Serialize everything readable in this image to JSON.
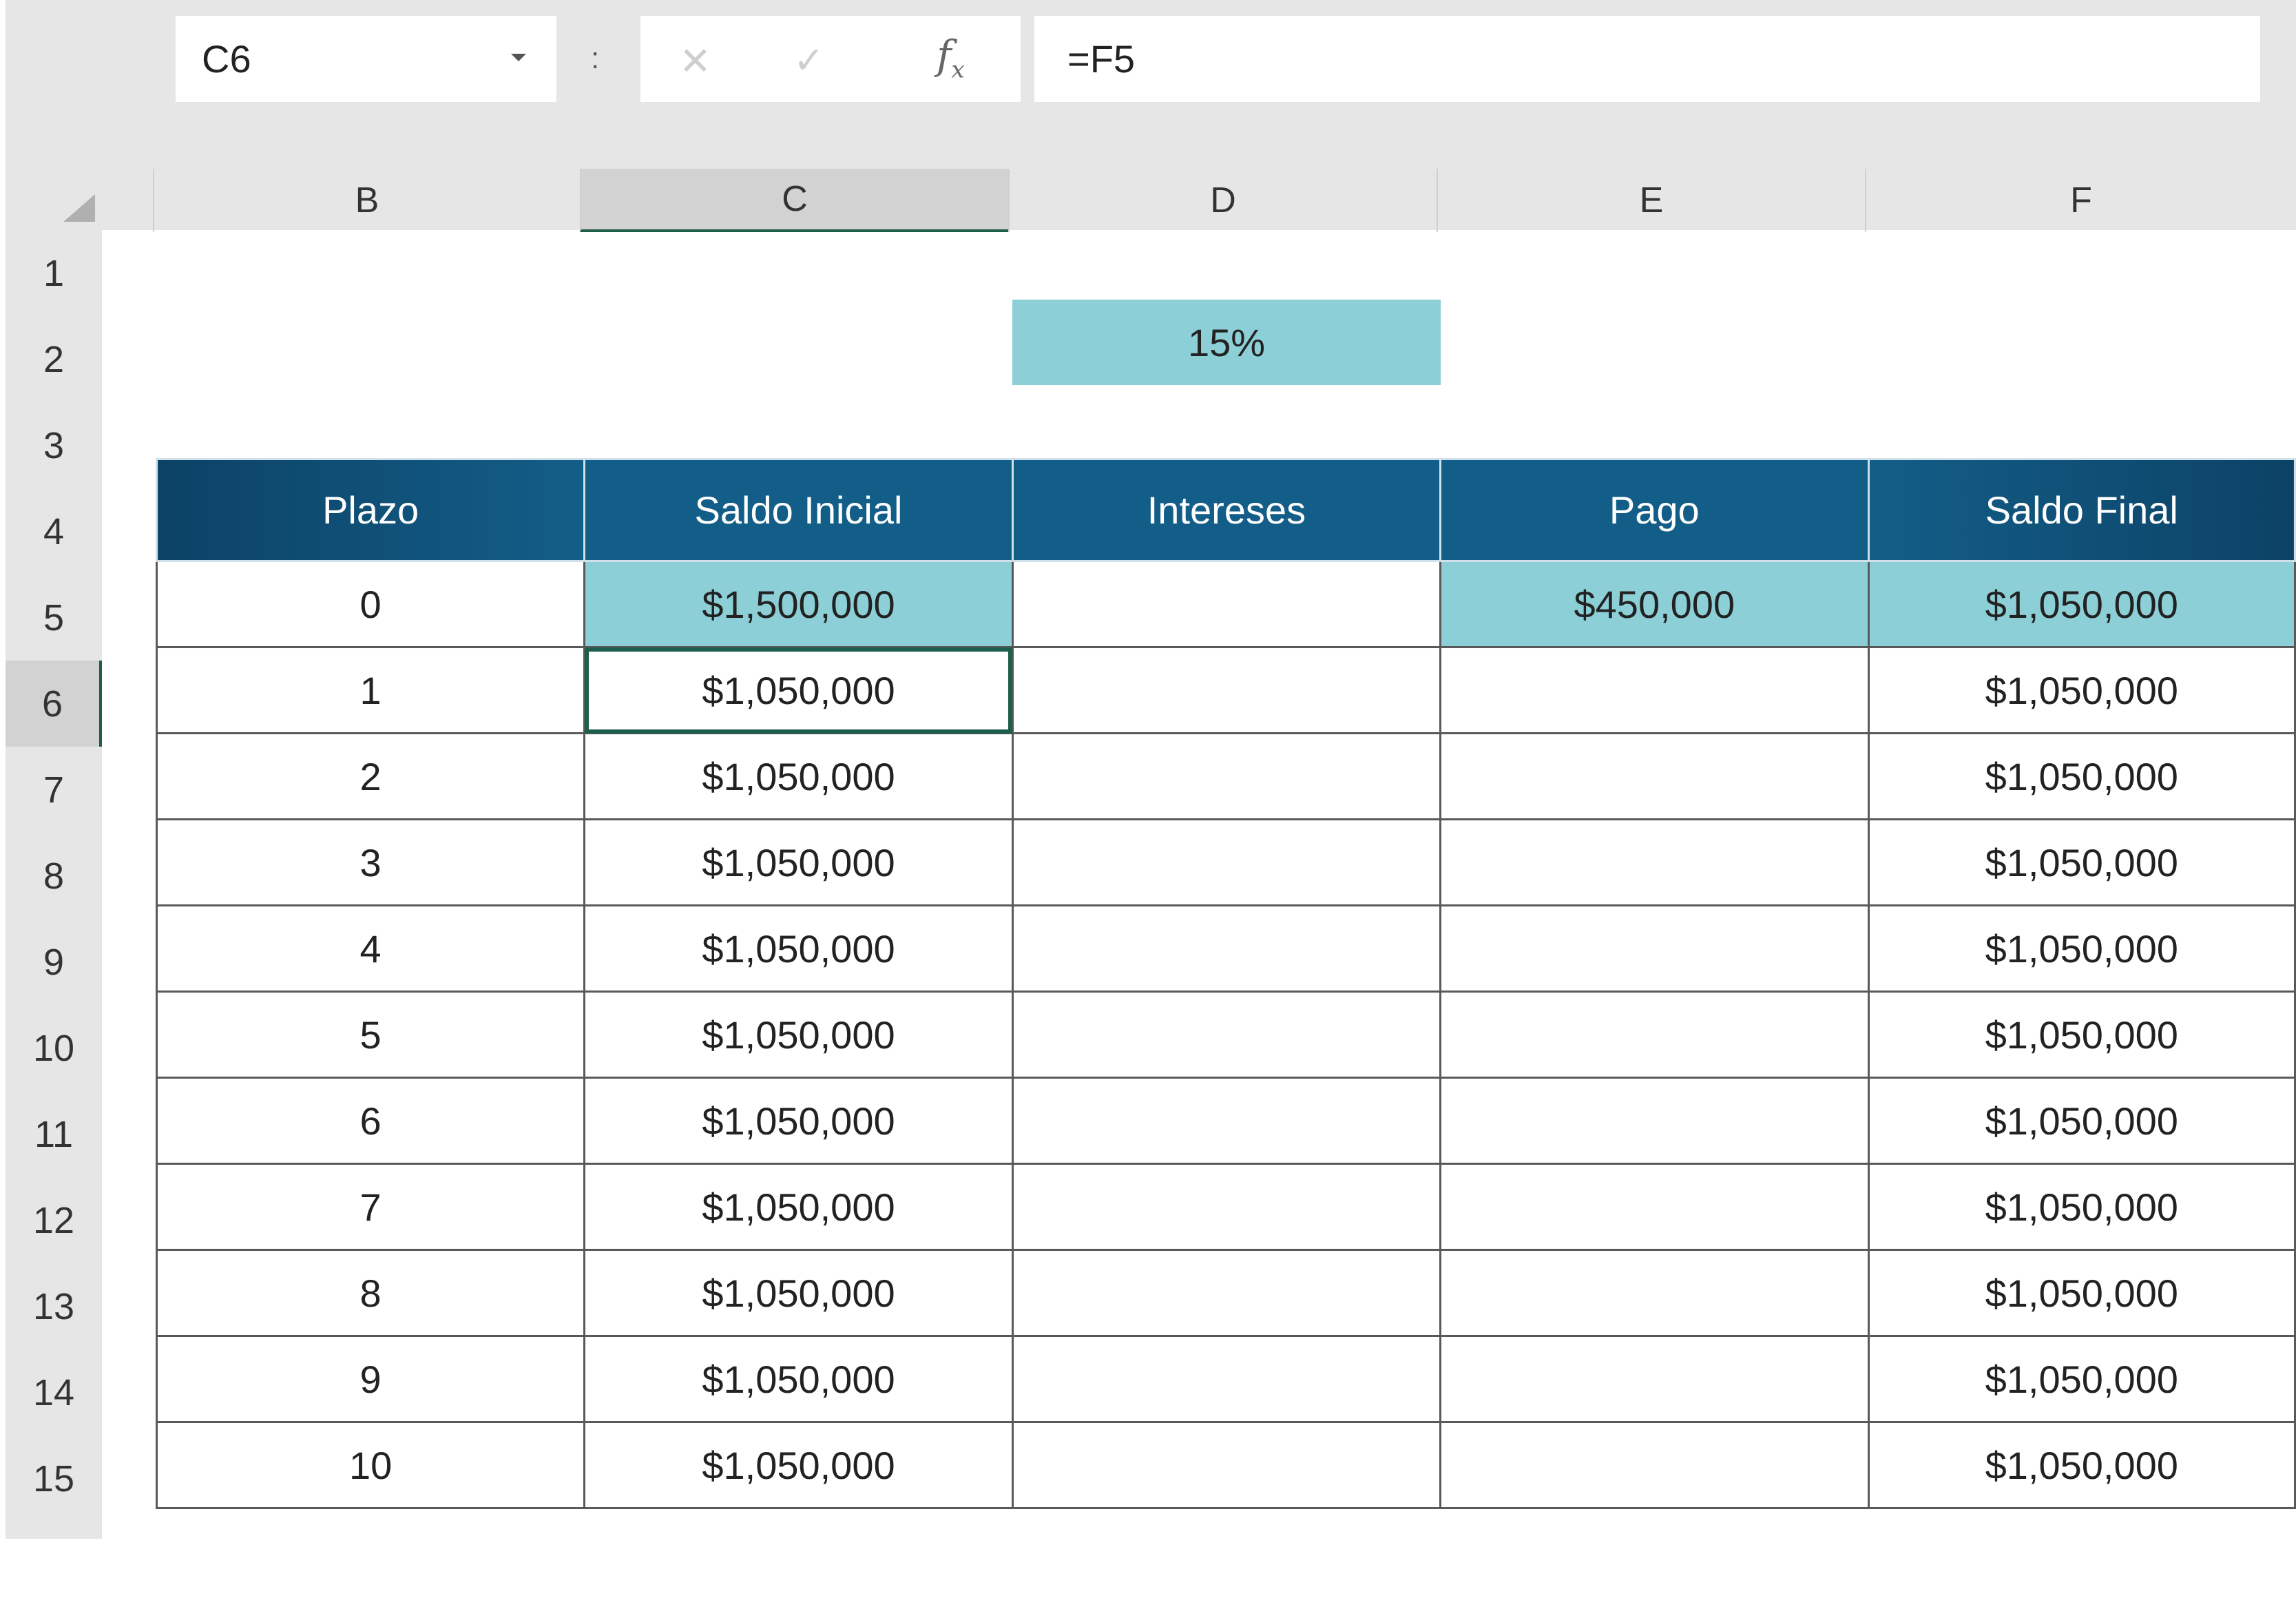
{
  "formula_bar": {
    "name_box": "C6",
    "separator": ":",
    "cancel_icon": "✕",
    "enter_icon": "✓",
    "fx_label": "f",
    "fx_sub": "x",
    "formula": "=F5"
  },
  "columns": [
    "B",
    "C",
    "D",
    "E",
    "F"
  ],
  "selected_column": "C",
  "rows": [
    "1",
    "2",
    "3",
    "4",
    "5",
    "6",
    "7",
    "8",
    "9",
    "10",
    "11",
    "12",
    "13",
    "14",
    "15"
  ],
  "selected_row": "6",
  "rate_cell": "15%",
  "table": {
    "headers": [
      "Plazo",
      "Saldo Inicial",
      "Intereses",
      "Pago",
      "Saldo Final"
    ],
    "rows": [
      [
        "0",
        "$1,500,000",
        "",
        "$450,000",
        "$1,050,000"
      ],
      [
        "1",
        "$1,050,000",
        "",
        "",
        "$1,050,000"
      ],
      [
        "2",
        "$1,050,000",
        "",
        "",
        "$1,050,000"
      ],
      [
        "3",
        "$1,050,000",
        "",
        "",
        "$1,050,000"
      ],
      [
        "4",
        "$1,050,000",
        "",
        "",
        "$1,050,000"
      ],
      [
        "5",
        "$1,050,000",
        "",
        "",
        "$1,050,000"
      ],
      [
        "6",
        "$1,050,000",
        "",
        "",
        "$1,050,000"
      ],
      [
        "7",
        "$1,050,000",
        "",
        "",
        "$1,050,000"
      ],
      [
        "8",
        "$1,050,000",
        "",
        "",
        "$1,050,000"
      ],
      [
        "9",
        "$1,050,000",
        "",
        "",
        "$1,050,000"
      ],
      [
        "10",
        "$1,050,000",
        "",
        "",
        "$1,050,000"
      ]
    ]
  },
  "colors": {
    "header_blue": "#135e88",
    "teal_fill": "#8ccfd6",
    "selection_green": "#1d5f4c"
  }
}
